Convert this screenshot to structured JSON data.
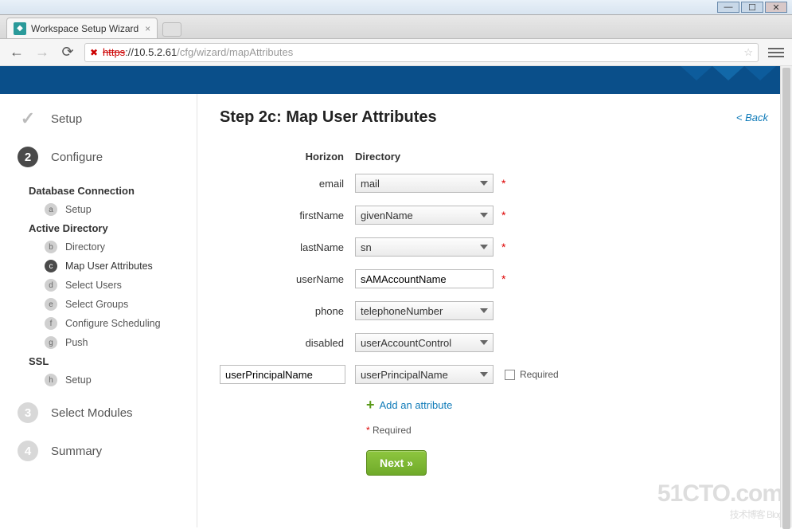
{
  "window": {
    "tab_title": "Workspace Setup Wizard",
    "url_proto": "https",
    "url_host": "://10.5.2.61",
    "url_path": "/cfg/wizard/mapAttributes"
  },
  "page": {
    "title": "Step 2c: Map User Attributes",
    "back": "< Back"
  },
  "sidebar": {
    "steps": [
      {
        "num": "✓",
        "label": "Setup"
      },
      {
        "num": "2",
        "label": "Configure"
      },
      {
        "num": "3",
        "label": "Select Modules"
      },
      {
        "num": "4",
        "label": "Summary"
      }
    ],
    "group_db": "Database Connection",
    "db_items": [
      {
        "badge": "a",
        "label": "Setup"
      }
    ],
    "group_ad": "Active Directory",
    "ad_items": [
      {
        "badge": "b",
        "label": "Directory"
      },
      {
        "badge": "c",
        "label": "Map User Attributes"
      },
      {
        "badge": "d",
        "label": "Select Users"
      },
      {
        "badge": "e",
        "label": "Select Groups"
      },
      {
        "badge": "f",
        "label": "Configure Scheduling"
      },
      {
        "badge": "g",
        "label": "Push"
      }
    ],
    "group_ssl": "SSL",
    "ssl_items": [
      {
        "badge": "h",
        "label": "Setup"
      }
    ]
  },
  "form": {
    "header_left": "Horizon",
    "header_right": "Directory",
    "rows": [
      {
        "label": "email",
        "value": "mail",
        "type": "select",
        "required": true
      },
      {
        "label": "firstName",
        "value": "givenName",
        "type": "select",
        "required": true
      },
      {
        "label": "lastName",
        "value": "sn",
        "type": "select",
        "required": true
      },
      {
        "label": "userName",
        "value": "sAMAccountName",
        "type": "text",
        "required": true
      },
      {
        "label": "phone",
        "value": "telephoneNumber",
        "type": "select",
        "required": false
      },
      {
        "label": "disabled",
        "value": "userAccountControl",
        "type": "select",
        "required": false
      }
    ],
    "custom_row": {
      "label": "userPrincipalName",
      "value": "userPrincipalName",
      "checkbox_label": "Required"
    },
    "add_attr": "Add an attribute",
    "required_note": "Required",
    "next": "Next »"
  },
  "watermark": {
    "main": "51CTO.com",
    "sub": "技术博客  Blog"
  }
}
